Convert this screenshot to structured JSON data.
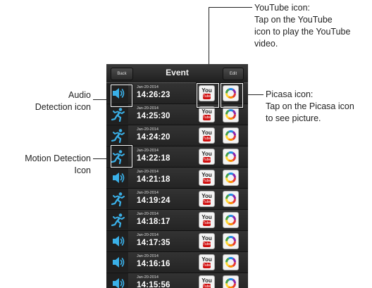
{
  "annotations": {
    "youtube": [
      "YouTube icon:",
      "Tap on the YouTube",
      "icon to play the YouTube",
      "video."
    ],
    "audio": [
      "Audio",
      "Detection icon"
    ],
    "picasa": [
      "Picasa icon:",
      "Tap on the Picasa icon",
      "to see picture."
    ],
    "motion": [
      "Motion Detection",
      "Icon"
    ]
  },
  "navbar": {
    "title": "Event",
    "back_label": "Back",
    "edit_label": "Edit"
  },
  "icons": {
    "youtube_you": "You",
    "youtube_tube": "Tube"
  },
  "events": [
    {
      "type": "audio",
      "date": "Jan-20-2014",
      "time": "14:26:23"
    },
    {
      "type": "motion",
      "date": "Jan-20-2014",
      "time": "14:25:30"
    },
    {
      "type": "motion",
      "date": "Jan-20-2014",
      "time": "14:24:20"
    },
    {
      "type": "motion",
      "date": "Jan-20-2014",
      "time": "14:22:18"
    },
    {
      "type": "audio",
      "date": "Jan-20-2014",
      "time": "14:21:18"
    },
    {
      "type": "motion",
      "date": "Jan-20-2014",
      "time": "14:19:24"
    },
    {
      "type": "motion",
      "date": "Jan-20-2014",
      "time": "14:18:17"
    },
    {
      "type": "audio",
      "date": "Jan-20-2014",
      "time": "14:17:35"
    },
    {
      "type": "audio",
      "date": "Jan-20-2014",
      "time": "14:16:16"
    },
    {
      "type": "audio",
      "date": "Jan-20-2014",
      "time": "14:15:56"
    }
  ],
  "colors": {
    "accent": "#3ab0e8",
    "youtube_red": "#d01010"
  }
}
